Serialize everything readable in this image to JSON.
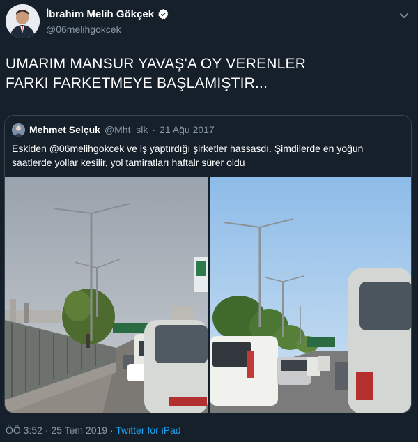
{
  "author": {
    "display_name": "İbrahim Melih Gökçek",
    "handle": "@06melihgokcek",
    "verified_icon": "verified-badge-icon",
    "avatar": "avatar-photo"
  },
  "menu_icon": "chevron-down-icon",
  "tweet": {
    "lines": [
      "UMARIM MANSUR YAVAŞ'A OY VERENLER",
      "FARKI FARKETMEYE BAŞLAMIŞTIR..."
    ]
  },
  "quoted_tweet": {
    "display_name": "Mehmet Selçuk",
    "handle": "@Mht_slk",
    "separator": "·",
    "date": "21 Ağu 2017",
    "lines": [
      "Eskiden @06melihgokcek ve iş yaptırdığı şirketler hassasdı. Şimdilerde en yoğun",
      "saatlerde yollar kesilir, yol tamiratları haftalr sürer oldu"
    ],
    "photos": [
      "highway-traffic-photo-left",
      "highway-traffic-photo-right"
    ]
  },
  "footer": {
    "time": "ÖÖ 3:52",
    "separator1": "·",
    "date": "25 Tem 2019",
    "separator2": "·",
    "source": "Twitter for iPad"
  },
  "colors": {
    "background": "#15202b",
    "secondary_text": "#8899a6",
    "link": "#1da1f2",
    "border": "#38444d"
  }
}
